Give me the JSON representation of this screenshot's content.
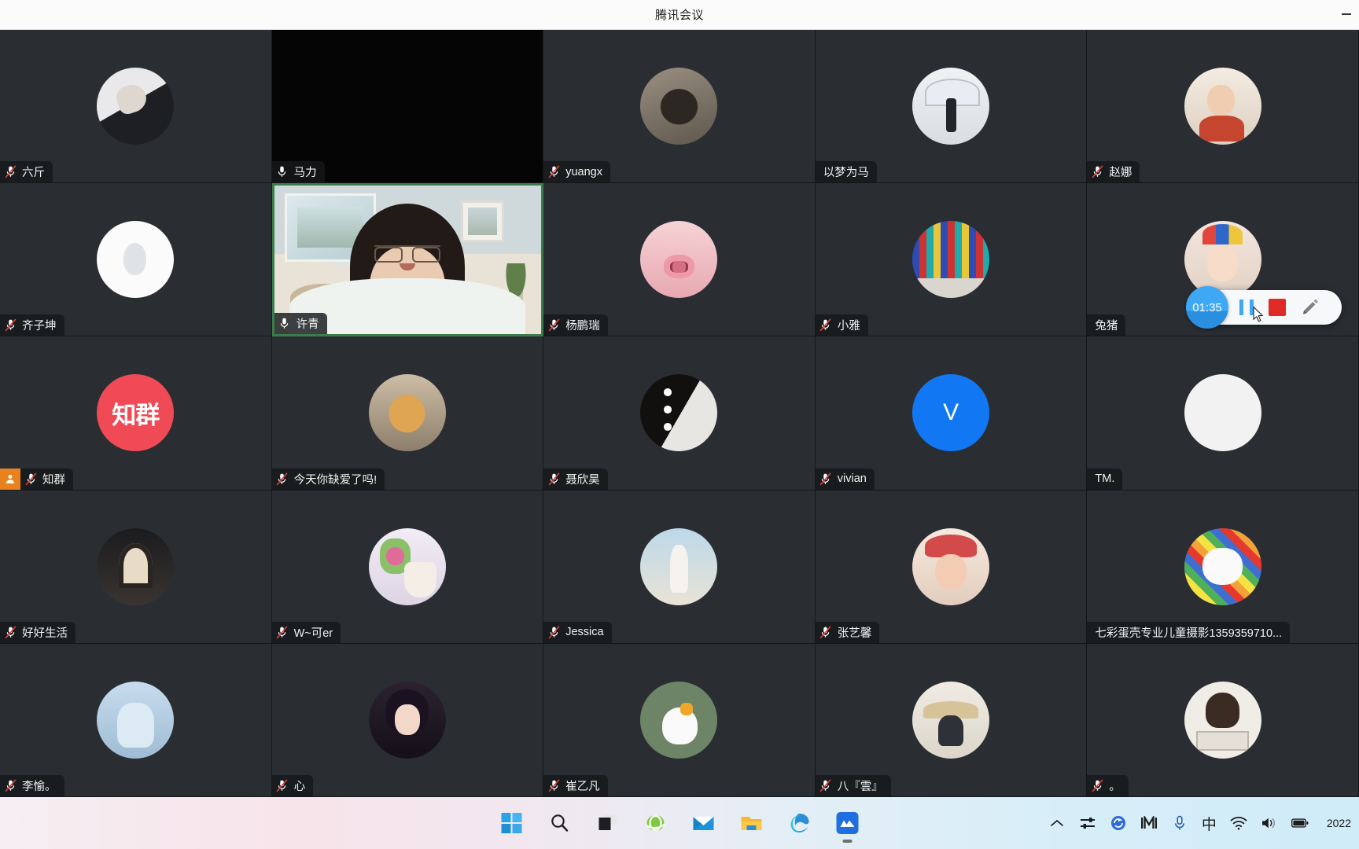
{
  "window": {
    "title": "腾讯会议",
    "minimize_label": "—"
  },
  "grid": {
    "rows": 5,
    "cols": 5,
    "participants": [
      {
        "name": "六斤",
        "mic": "muted",
        "host": false,
        "art": "ph-hand",
        "tile": "normal"
      },
      {
        "name": "马力",
        "mic": "unmuted",
        "host": false,
        "art": "none",
        "tile": "dark"
      },
      {
        "name": "yuangx",
        "mic": "muted",
        "host": false,
        "art": "ph-dog1",
        "tile": "normal"
      },
      {
        "name": "以梦为马",
        "mic": "none",
        "host": false,
        "art": "ph-umbrella",
        "tile": "normal"
      },
      {
        "name": "赵娜",
        "mic": "muted",
        "host": false,
        "art": "ph-kid",
        "tile": "normal"
      },
      {
        "name": "齐子坤",
        "mic": "muted",
        "host": false,
        "art": "ph-cat-white",
        "tile": "normal"
      },
      {
        "name": "许青",
        "mic": "unmuted",
        "host": false,
        "art": "video",
        "tile": "video"
      },
      {
        "name": "杨鹏瑞",
        "mic": "muted",
        "host": false,
        "art": "ph-pig",
        "tile": "normal"
      },
      {
        "name": "小雅",
        "mic": "muted",
        "host": false,
        "art": "ph-mosaic",
        "tile": "normal"
      },
      {
        "name": "兔猪",
        "mic": "none",
        "host": false,
        "art": "ph-clown",
        "tile": "normal"
      },
      {
        "name": "知群",
        "mic": "muted",
        "host": true,
        "art": "ph-zhiqun",
        "tile": "normal",
        "art_text": "知群"
      },
      {
        "name": "今天你缺爱了吗!",
        "mic": "muted",
        "host": false,
        "art": "ph-shiba",
        "tile": "normal"
      },
      {
        "name": "聂欣昊",
        "mic": "muted",
        "host": false,
        "art": "ph-blackwhite",
        "tile": "normal"
      },
      {
        "name": "vivian",
        "mic": "muted",
        "host": false,
        "art": "ph-blue",
        "tile": "normal",
        "art_text": "V"
      },
      {
        "name": "TM.",
        "mic": "none",
        "host": false,
        "art": "ph-white",
        "tile": "normal"
      },
      {
        "name": "好好生活",
        "mic": "muted",
        "host": false,
        "art": "ph-house",
        "tile": "normal"
      },
      {
        "name": "W~可er",
        "mic": "muted",
        "host": false,
        "art": "ph-flowers",
        "tile": "normal"
      },
      {
        "name": "Jessica",
        "mic": "muted",
        "host": false,
        "art": "ph-dress",
        "tile": "normal"
      },
      {
        "name": "张艺馨",
        "mic": "muted",
        "host": false,
        "art": "ph-girlhat",
        "tile": "normal"
      },
      {
        "name": "七彩蛋壳专业儿童摄影1359359710...",
        "mic": "none",
        "host": false,
        "art": "ph-colorful",
        "tile": "normal"
      },
      {
        "name": "李愉。",
        "mic": "muted",
        "host": false,
        "art": "ph-blueclothes",
        "tile": "normal"
      },
      {
        "name": "心",
        "mic": "muted",
        "host": false,
        "art": "ph-anime",
        "tile": "normal"
      },
      {
        "name": "崔乙凡",
        "mic": "muted",
        "host": false,
        "art": "ph-goose",
        "tile": "normal"
      },
      {
        "name": "八『雲』",
        "mic": "muted",
        "host": false,
        "art": "ph-hat",
        "tile": "normal"
      },
      {
        "name": "。",
        "mic": "muted",
        "host": false,
        "art": "ph-girls",
        "tile": "normal"
      }
    ]
  },
  "recorder": {
    "timer": "01:35",
    "pause_label": "Pause",
    "stop_label": "Stop",
    "annotate_label": "Annotate"
  },
  "taskbar": {
    "items": [
      {
        "icon": "windows-start-icon",
        "label": "Start"
      },
      {
        "icon": "search-icon",
        "label": "Search"
      },
      {
        "icon": "task-view-icon",
        "label": "Task View"
      },
      {
        "icon": "internet-explorer-icon",
        "label": "Internet Explorer"
      },
      {
        "icon": "mail-icon",
        "label": "Mail"
      },
      {
        "icon": "file-explorer-icon",
        "label": "File Explorer"
      },
      {
        "icon": "edge-icon",
        "label": "Microsoft Edge"
      },
      {
        "icon": "tencent-meeting-icon",
        "label": "腾讯会议",
        "active": true
      }
    ],
    "tray": [
      {
        "icon": "chevron-up-icon",
        "label": "Show hidden icons"
      },
      {
        "icon": "sliders-icon",
        "label": "Settings"
      },
      {
        "icon": "sync-icon",
        "label": "Sync"
      },
      {
        "icon": "recorder-icon",
        "label": "Recorder"
      },
      {
        "icon": "microphone-icon",
        "label": "Microphone"
      },
      {
        "icon": "ime-icon",
        "label": "中"
      },
      {
        "icon": "wifi-icon",
        "label": "Network"
      },
      {
        "icon": "volume-icon",
        "label": "Volume"
      },
      {
        "icon": "battery-icon",
        "label": "Battery"
      }
    ],
    "clock": "2022"
  },
  "colors": {
    "tile_bg": "#2a2e33",
    "nameplate_bg": "#16181b",
    "speaking_border": "#3a7d4a",
    "host_badge": "#e8821e",
    "muted_red": "#d9413c",
    "recorder_blue": "#3ea8f5",
    "recorder_red": "#e02a26"
  }
}
